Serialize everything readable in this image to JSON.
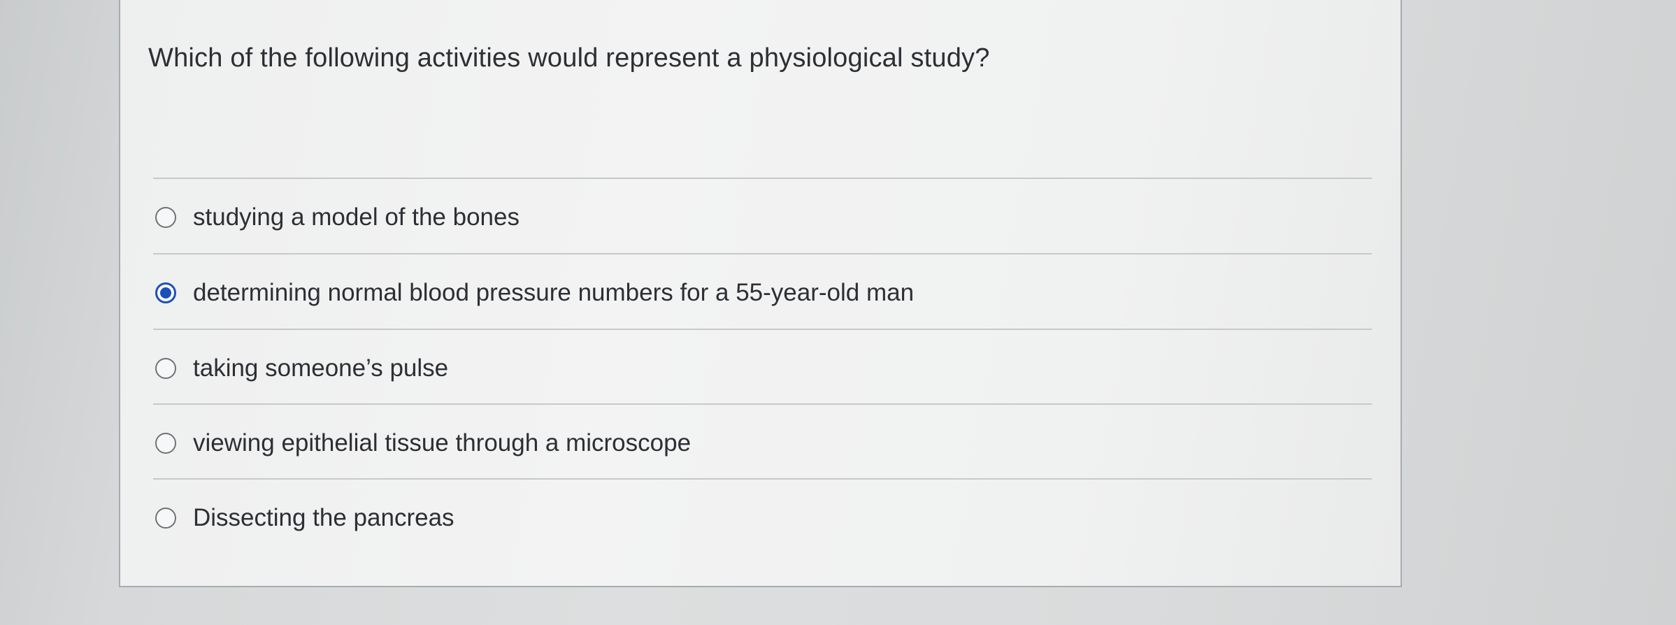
{
  "question": {
    "text": "Which of the following activities would represent a physiological study?"
  },
  "options": [
    {
      "label": "studying a model of the bones",
      "selected": false
    },
    {
      "label": "determining normal blood pressure numbers for a 55-year-old man",
      "selected": true
    },
    {
      "label": "taking someone’s pulse",
      "selected": false
    },
    {
      "label": "viewing epithelial tissue through a microscope",
      "selected": false
    },
    {
      "label": "Dissecting the pancreas",
      "selected": false
    }
  ],
  "colors": {
    "radio_selected": "#1d4fb8",
    "text": "#2c2f33"
  }
}
